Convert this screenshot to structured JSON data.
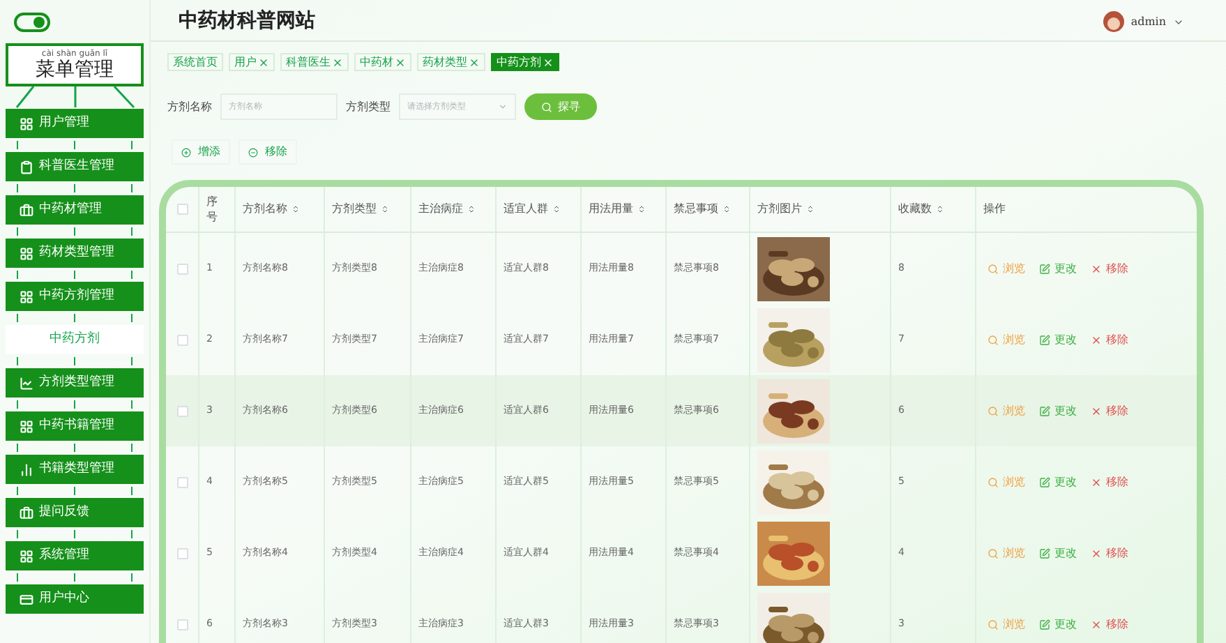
{
  "header": {
    "title": "中药材科普网站",
    "user": "admin"
  },
  "sidebar": {
    "toggle_on": true,
    "tree_pinyin": "cài shàn guǎn lǐ",
    "tree_title": "菜单管理",
    "items": [
      {
        "label": "用户管理",
        "kind": "menu",
        "selected": false
      },
      {
        "label": "科普医生管理",
        "kind": "menu",
        "selected": false
      },
      {
        "label": "中药材管理",
        "kind": "menu",
        "selected": false
      },
      {
        "label": "药材类型管理",
        "kind": "menu",
        "selected": false
      },
      {
        "label": "中药方剂管理",
        "kind": "menu",
        "selected": false
      },
      {
        "label": "中药方剂",
        "kind": "submenu",
        "selected": true
      },
      {
        "label": "方剂类型管理",
        "kind": "menu",
        "selected": false
      },
      {
        "label": "中药书籍管理",
        "kind": "menu",
        "selected": false
      },
      {
        "label": "书籍类型管理",
        "kind": "menu",
        "selected": false
      },
      {
        "label": "提问反馈",
        "kind": "menu",
        "selected": false
      },
      {
        "label": "系统管理",
        "kind": "menu",
        "selected": false
      },
      {
        "label": "用户中心",
        "kind": "menu",
        "selected": false
      }
    ]
  },
  "tags": [
    {
      "label": "系统首页",
      "closable": false,
      "selected": false
    },
    {
      "label": "用户",
      "closable": true,
      "selected": false
    },
    {
      "label": "科普医生",
      "closable": true,
      "selected": false
    },
    {
      "label": "中药材",
      "closable": true,
      "selected": false
    },
    {
      "label": "药材类型",
      "closable": true,
      "selected": false
    },
    {
      "label": "中药方剂",
      "closable": true,
      "selected": true
    }
  ],
  "search": {
    "fields": [
      {
        "label": "方剂名称",
        "placeholder": "方剂名称",
        "kind": "text"
      },
      {
        "label": "方剂类型",
        "placeholder": "请选择方剂类型",
        "kind": "select"
      }
    ],
    "button": "探寻"
  },
  "actions": [
    {
      "label": "增添",
      "kind": "add"
    },
    {
      "label": "移除",
      "kind": "remove"
    }
  ],
  "table": {
    "select_all": false,
    "columns": [
      {
        "label": "序号",
        "sortable": false
      },
      {
        "label": "方剂名称",
        "sortable": true
      },
      {
        "label": "方剂类型",
        "sortable": true
      },
      {
        "label": "主治病症",
        "sortable": true
      },
      {
        "label": "适宜人群",
        "sortable": true
      },
      {
        "label": "用法用量",
        "sortable": true
      },
      {
        "label": "禁忌事项",
        "sortable": true
      },
      {
        "label": "方剂图片",
        "sortable": true
      },
      {
        "label": "收藏数",
        "sortable": true
      },
      {
        "label": "操作",
        "sortable": false
      }
    ],
    "rows": [
      {
        "cells": [
          "1",
          "方剂名称8",
          "方剂类型8",
          "主治病症8",
          "适宜人群8",
          "用法用量8",
          "禁忌事项8"
        ],
        "favorites": "8",
        "actions": [
          "浏览",
          "更改",
          "移除"
        ],
        "highlighted": false,
        "checked": false
      },
      {
        "cells": [
          "2",
          "方剂名称7",
          "方剂类型7",
          "主治病症7",
          "适宜人群7",
          "用法用量7",
          "禁忌事项7"
        ],
        "favorites": "7",
        "actions": [
          "浏览",
          "更改",
          "移除"
        ],
        "highlighted": false,
        "checked": false
      },
      {
        "cells": [
          "3",
          "方剂名称6",
          "方剂类型6",
          "主治病症6",
          "适宜人群6",
          "用法用量6",
          "禁忌事项6"
        ],
        "favorites": "6",
        "actions": [
          "浏览",
          "更改",
          "移除"
        ],
        "highlighted": true,
        "checked": false
      },
      {
        "cells": [
          "4",
          "方剂名称5",
          "方剂类型5",
          "主治病症5",
          "适宜人群5",
          "用法用量5",
          "禁忌事项5"
        ],
        "favorites": "5",
        "actions": [
          "浏览",
          "更改",
          "移除"
        ],
        "highlighted": false,
        "checked": false
      },
      {
        "cells": [
          "5",
          "方剂名称4",
          "方剂类型4",
          "主治病症4",
          "适宜人群4",
          "用法用量4",
          "禁忌事项4"
        ],
        "favorites": "4",
        "actions": [
          "浏览",
          "更改",
          "移除"
        ],
        "highlighted": false,
        "checked": false
      },
      {
        "cells": [
          "6",
          "方剂名称3",
          "方剂类型3",
          "主治病症3",
          "适宜人群3",
          "用法用量3",
          "禁忌事项3"
        ],
        "favorites": "3",
        "actions": [
          "浏览",
          "更改",
          "移除"
        ],
        "highlighted": false,
        "checked": false
      }
    ]
  }
}
